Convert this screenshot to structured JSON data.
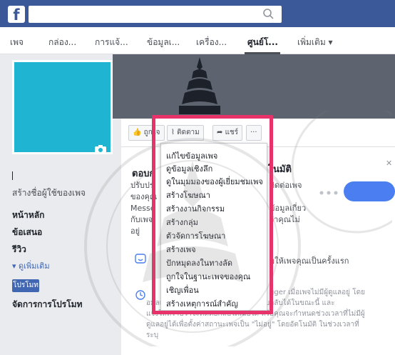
{
  "top_bar": {
    "logo_letter": "f",
    "search_icon": "search-icon",
    "color": "#3b5998"
  },
  "nav": {
    "tabs": [
      {
        "label": "เพจ"
      },
      {
        "label": "กล่อง..."
      },
      {
        "label": "การแจ้..."
      },
      {
        "label": "ข้อมูลเ..."
      },
      {
        "label": "เครื่อง..."
      },
      {
        "label": "ศูนย์โ..."
      },
      {
        "label": "เพิ่มเติม ▾"
      }
    ],
    "active_tab": "ศูนย์โ..."
  },
  "sidebar": {
    "create_username": "สร้างชื่อผู้ใช้ของเพจ",
    "items": [
      {
        "label": "หน้าหลัก"
      },
      {
        "label": "ข้อเสนอ"
      },
      {
        "label": "รีวิว"
      }
    ],
    "see_more": "▾  ดูเพิ่มเติม",
    "promote_button": "โปรโมท",
    "manage_promotions": "จัดการการโปรโมท",
    "profile_color": "#1fb5d2"
  },
  "action_bar": {
    "like": "ถูกใจ",
    "follow": "ติดตาม",
    "share": "แชร์",
    "more": "···"
  },
  "card": {
    "title_left": "ตอบก",
    "title_right": "โนมัติ",
    "lines_left": [
      "ปรับปรุ",
      "ของคุณ",
      "Messe",
      "กับเพจ",
      "อยู่"
    ],
    "lines_right": [
      "ติดต่อเพจ",
      "ข้อมูลเกี่ยว",
      "ว่าคุณไม่"
    ],
    "feature1_text": "มให้เพจคุณเป็นครั้งแรก",
    "feature2_text_line1": "gger เมื่อเพจไม่มีผู้ดูแลอยู่ โดย",
    "feature2_text_line2": "อมูลเพื่อบอกบุคคลอื่นว่าคุณสามารถตอบกลับได้ในขณะนี้ และ",
    "feature2_text_line3": "แจ้งให้ทราบว่าจะติดต่อกลับได้เมื่อใด หรือคุณจะกำหนดช่วงเวลาที่ไม่มีผู้",
    "feature2_text_line4": "ดูแลอยู่ได้เพื่อตั้งค่าสถานะเพจเป็น \"ไม่อยู่\" โดยอัตโนมัติ ในช่วงเวลาที่",
    "feature2_text_line5": "ระบุ",
    "accent": "#4b7ef0"
  },
  "dropdown": {
    "items": [
      {
        "label": "แก้ไขข้อมูลเพจ"
      },
      {
        "label": "ดูข้อมูลเชิงลึก"
      },
      {
        "label": "ดูในมุมมองของผู้เยี่ยมชมเพจ"
      },
      {
        "label": "สร้างโฆษณา"
      },
      {
        "label": "สร้างงานกิจกรรม"
      },
      {
        "label": "สร้างกลุ่ม"
      },
      {
        "label": "ตัวจัดการโฆษณา"
      },
      {
        "label": "สร้างเพจ"
      },
      {
        "label": "ปักหมุดลงในทางลัด"
      },
      {
        "label": "ถูกใจในฐานะเพจของคุณ"
      },
      {
        "label": "เชิญเพื่อน"
      },
      {
        "label": "สร้างเหตุการณ์สำคัญ"
      }
    ],
    "highlight_color": "#e8336a"
  }
}
